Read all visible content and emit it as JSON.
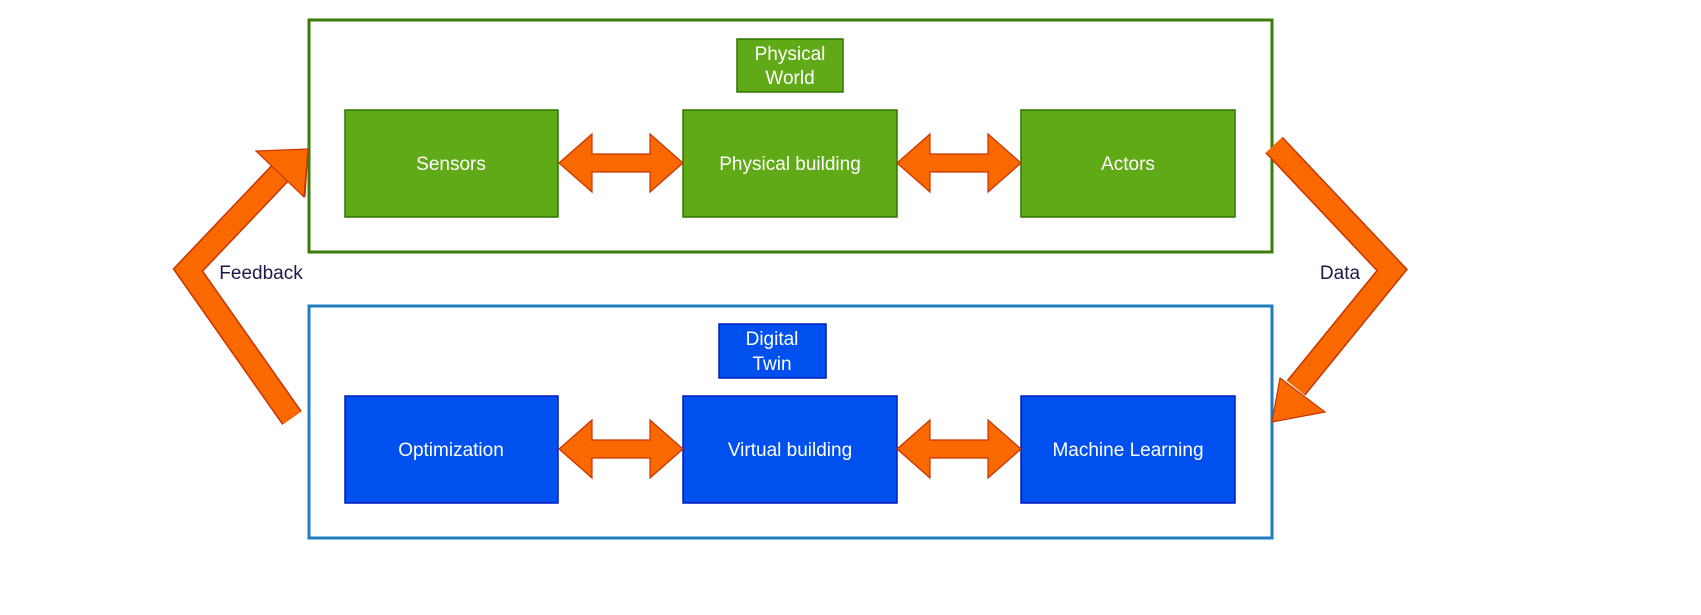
{
  "colors": {
    "physical_fill": "#60a917",
    "physical_stroke": "#2d7600",
    "physical_container": "#3a7d0a",
    "digital_fill": "#0050ef",
    "digital_stroke": "#001dbc",
    "digital_container": "#1f7dbf",
    "arrow_fill": "#fa6800",
    "arrow_stroke": "#c73500",
    "label_text": "#1c1a4a"
  },
  "physical_world": {
    "title_line1": "Physical",
    "title_line2": "World",
    "nodes": [
      "Sensors",
      "Physical building",
      "Actors"
    ]
  },
  "digital_twin": {
    "title_line1": "Digital",
    "title_line2": "Twin",
    "nodes": [
      "Optimization",
      "Virtual building",
      "Machine Learning"
    ]
  },
  "edges": {
    "feedback_label": "Feedback",
    "data_label": "Data"
  }
}
